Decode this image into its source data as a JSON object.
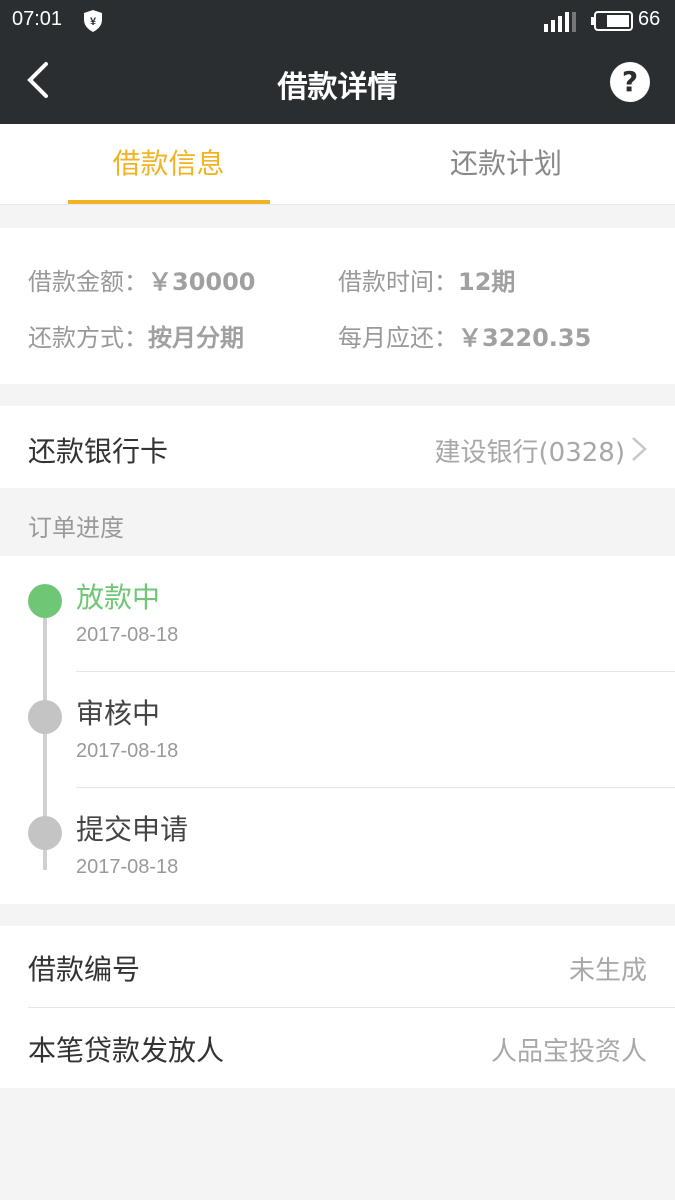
{
  "status_bar": {
    "time": "07:01",
    "battery": "66"
  },
  "navbar": {
    "title": "借款详情",
    "help_label": "?"
  },
  "tabs": [
    {
      "label": "借款信息",
      "active": true
    },
    {
      "label": "还款计划",
      "active": false
    }
  ],
  "loan_info": {
    "amount_label": "借款金额：",
    "amount_value": "￥30000",
    "term_label": "借款时间：",
    "term_value": "12期",
    "method_label": "还款方式：",
    "method_value": "按月分期",
    "monthly_label": "每月应还：",
    "monthly_value": "￥3220.35"
  },
  "repay_card": {
    "label": "还款银行卡",
    "value": "建设银行(0328)"
  },
  "order_progress": {
    "title": "订单进度",
    "steps": [
      {
        "title": "放款中",
        "date": "2017-08-18",
        "color": "#6fc775"
      },
      {
        "title": "审核中",
        "date": "2017-08-18",
        "color": "#c4c4c4"
      },
      {
        "title": "提交申请",
        "date": "2017-08-18",
        "color": "#c4c4c4"
      }
    ]
  },
  "meta": {
    "loan_no_label": "借款编号",
    "loan_no_value": "未生成",
    "lender_label": "本笔贷款发放人",
    "lender_value": "人品宝投资人"
  },
  "colors": {
    "accent": "#f0b323",
    "active_step": "#6fc775",
    "header_bg": "#2b2e31"
  }
}
